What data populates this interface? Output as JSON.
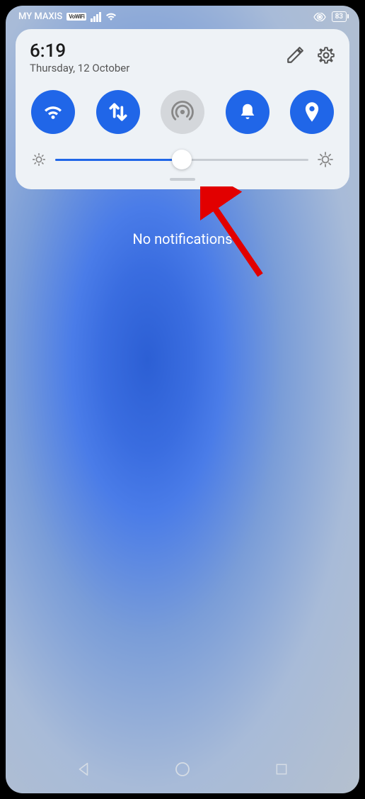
{
  "status_bar": {
    "carrier": "MY MAXIS",
    "vowifi": "VoWiFi",
    "battery": "83"
  },
  "panel": {
    "time": "6:19",
    "date": "Thursday, 12 October"
  },
  "notification_empty": "No notifications",
  "brightness_percent": 50
}
